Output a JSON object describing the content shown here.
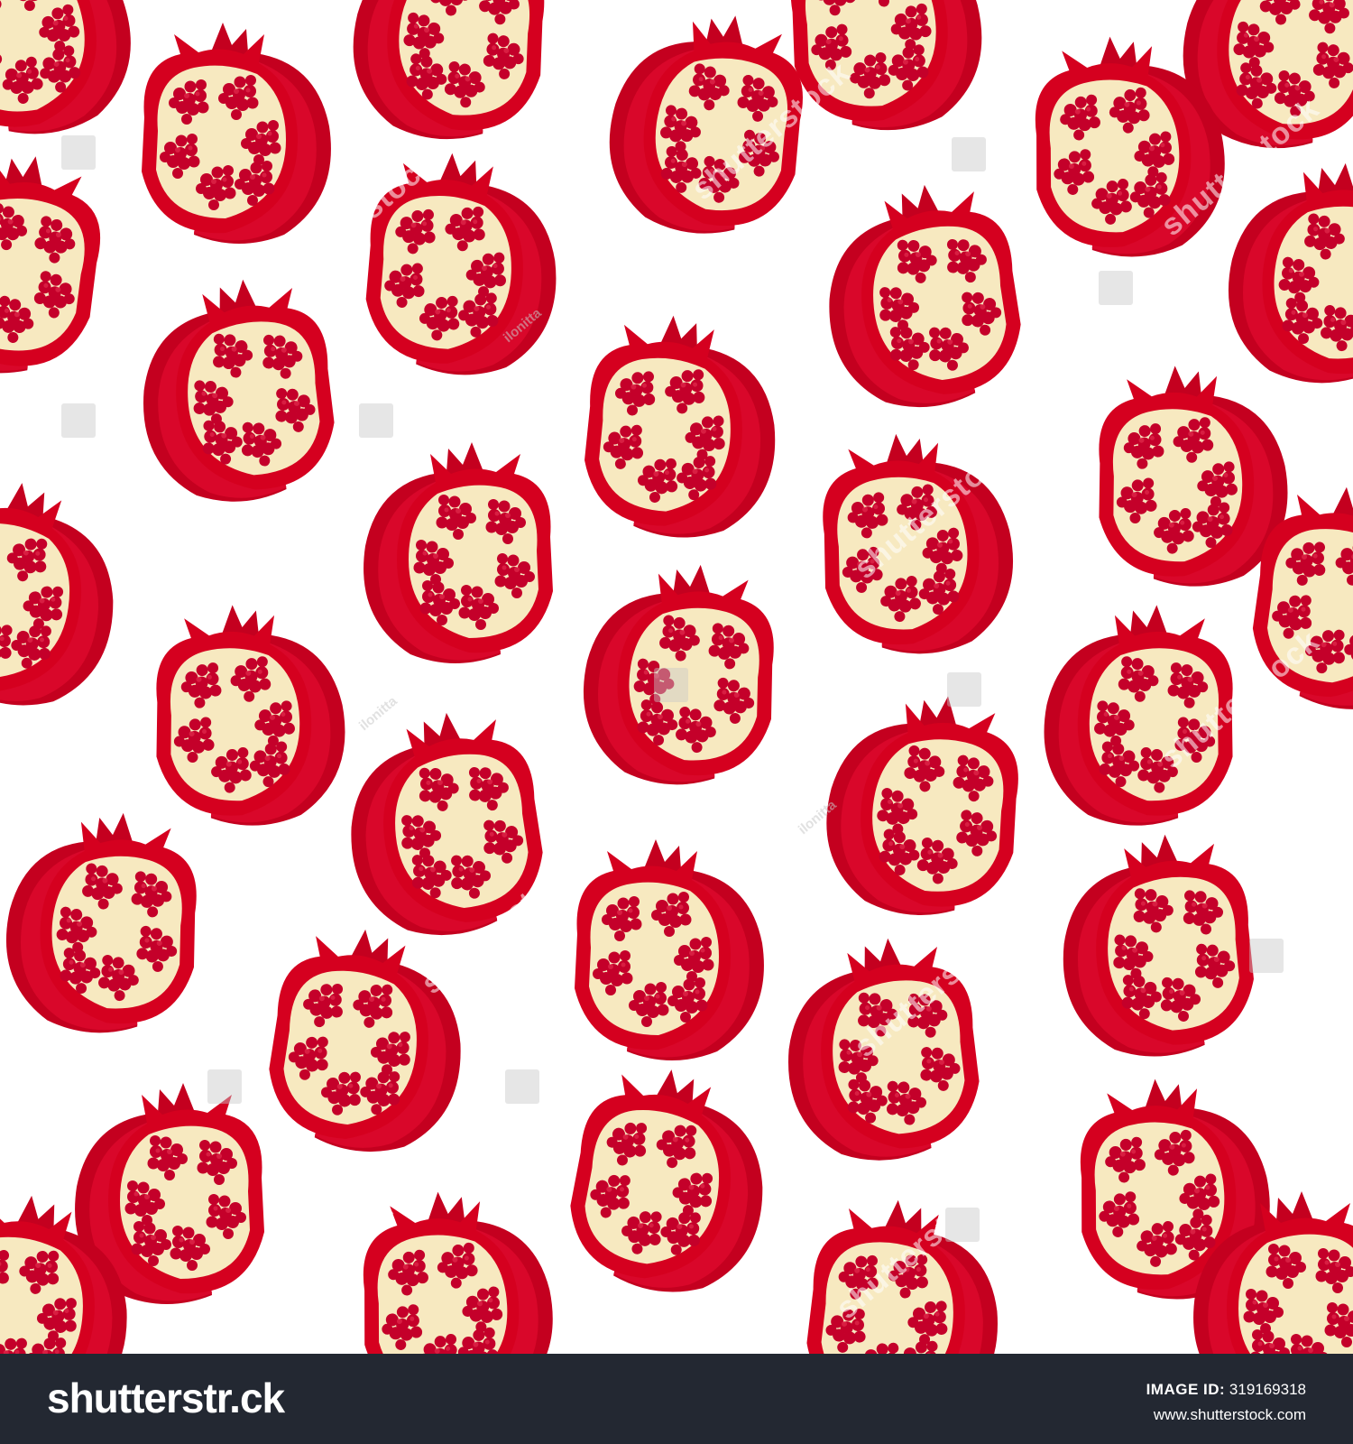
{
  "colors": {
    "background": "#ffffff",
    "rind_dark": "#b3001b",
    "rind_mid": "#cf0a26",
    "rind_light": "#e0102d",
    "pith": "#f7e9c0",
    "seed": "#c4002a",
    "seed_highlight": "#e93856",
    "footer_bg": "#232832",
    "footer_text": "#ffffff"
  },
  "pattern": {
    "motif": "pomegranate-half-icon"
  },
  "watermark": {
    "text": "shutterstock",
    "author": "ilonitta"
  },
  "footer": {
    "brand": "shutterstr.ck",
    "image_id_label": "IMAGE ID:",
    "image_id": "319169318",
    "site": "www.shutterstock.com"
  }
}
